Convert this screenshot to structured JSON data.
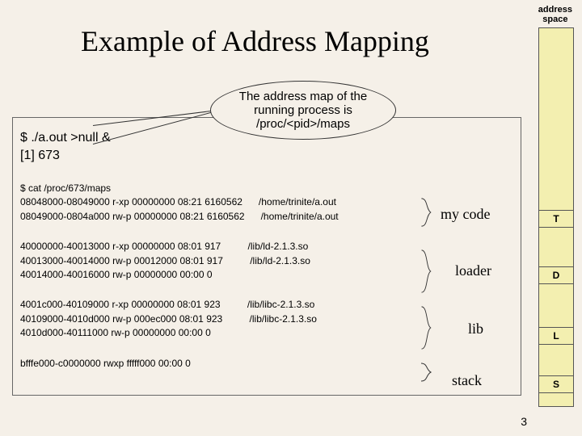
{
  "title": "Example of Address Mapping",
  "aspace_label_l1": "address",
  "aspace_label_l2": "space",
  "callout": {
    "l1": "The address map of the",
    "l2": "running process is",
    "l3": "/proc/<pid>/maps"
  },
  "prompt": {
    "l1": "$ ./a.out >null &",
    "l2": "[1] 673"
  },
  "terminal": {
    "cat": "$ cat /proc/673/maps",
    "b1l1": "08048000-08049000 r-xp 00000000 08:21 6160562      /home/trinite/a.out",
    "b1l2": "08049000-0804a000 rw-p 00000000 08:21 6160562      /home/trinite/a.out",
    "b2l1": "40000000-40013000 r-xp 00000000 08:01 917          /lib/ld-2.1.3.so",
    "b2l2": "40013000-40014000 rw-p 00012000 08:01 917          /lib/ld-2.1.3.so",
    "b2l3": "40014000-40016000 rw-p 00000000 00:00 0",
    "b3l1": "4001c000-40109000 r-xp 00000000 08:01 923          /lib/libc-2.1.3.so",
    "b3l2": "40109000-4010d000 rw-p 000ec000 08:01 923          /lib/libc-2.1.3.so",
    "b3l3": "4010d000-40111000 rw-p 00000000 00:00 0",
    "b4l1": "bfffe000-c0000000 rwxp fffff000 00:00 0"
  },
  "regions": {
    "code": "my code",
    "loader": "loader",
    "lib": "lib",
    "stack": "stack"
  },
  "segments": {
    "t": "T",
    "d": "D",
    "l": "L",
    "s": "S"
  },
  "page_num": "3"
}
